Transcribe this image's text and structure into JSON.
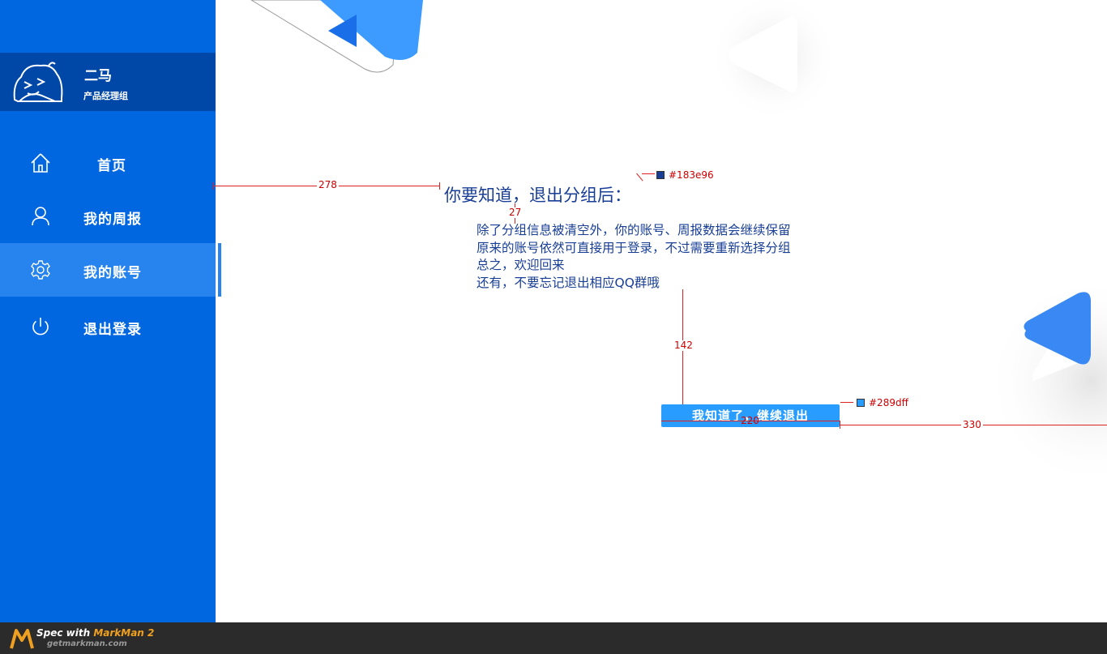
{
  "profile": {
    "name": "二马",
    "group": "产品经理组"
  },
  "nav": {
    "items": [
      {
        "label": "首页",
        "icon": "home-icon"
      },
      {
        "label": "我的周报",
        "icon": "user-icon"
      },
      {
        "label": "我的账号",
        "icon": "gear-icon"
      },
      {
        "label": "退出登录",
        "icon": "power-icon"
      }
    ],
    "active_index": 2
  },
  "main": {
    "heading": "你要知道，退出分组后：",
    "lines": [
      "除了分组信息被清空外，你的账号、周报数据会继续保留",
      "原来的账号依然可直接用于登录，不过需要重新选择分组",
      "总之，欢迎回来",
      "还有，不要忘记退出相应QQ群哦"
    ],
    "confirm_label": "我知道了，继续退出"
  },
  "spec": {
    "heading_color": "#183e96",
    "button_color": "#289dff",
    "left_offset": "278",
    "heading_gap": "27",
    "text_to_button": "142",
    "button_width": "220",
    "right_offset": "330"
  },
  "footer": {
    "spec_with": "Spec with ",
    "brand": "MarkMan 2",
    "url": "getmarkman.com"
  },
  "colors": {
    "sidebar": "#0067e1",
    "profile_bg": "#0048a8",
    "active_item": "#2783ee"
  }
}
